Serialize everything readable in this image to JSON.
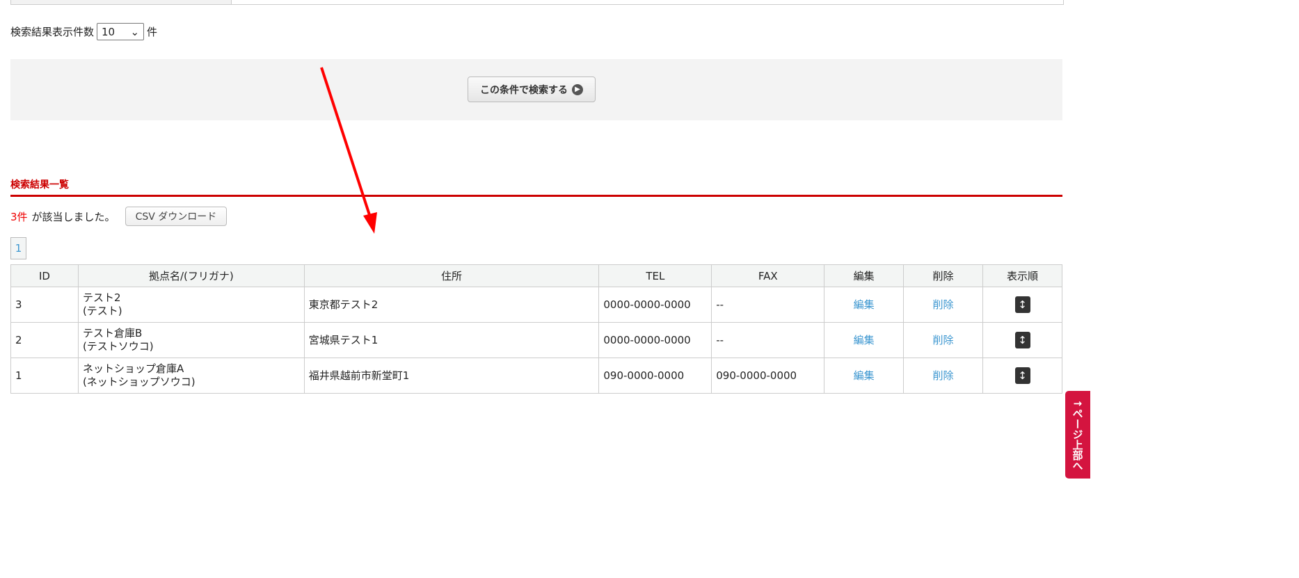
{
  "display_count": {
    "label": "検索結果表示件数",
    "value": "10",
    "unit": "件"
  },
  "search_button": "この条件で検索する",
  "results": {
    "heading": "検索結果一覧",
    "count": "3件",
    "count_suffix": "が該当しました。",
    "csv_button": "CSV ダウンロード",
    "page": "1",
    "columns": [
      "ID",
      "拠点名/(フリガナ)",
      "住所",
      "TEL",
      "FAX",
      "編集",
      "削除",
      "表示順"
    ],
    "rows": [
      {
        "id": "3",
        "name": "テスト2",
        "kana": "(テスト)",
        "address": "東京都テスト2",
        "tel": "0000-0000-0000",
        "fax": "--",
        "edit": "編集",
        "delete": "削除"
      },
      {
        "id": "2",
        "name": "テスト倉庫B",
        "kana": "(テストソウコ)",
        "address": "宮城県テスト1",
        "tel": "0000-0000-0000",
        "fax": "--",
        "edit": "編集",
        "delete": "削除"
      },
      {
        "id": "1",
        "name": "ネットショップ倉庫A",
        "kana": "(ネットショップソウコ)",
        "address": "福井県越前市新堂町1",
        "tel": "090-0000-0000",
        "fax": "090-0000-0000",
        "edit": "編集",
        "delete": "削除"
      }
    ]
  },
  "page_top": "↑ページ上部へ",
  "colors": {
    "accent": "#cc0000",
    "link": "#3b96d0",
    "page_top": "#d4143f"
  }
}
